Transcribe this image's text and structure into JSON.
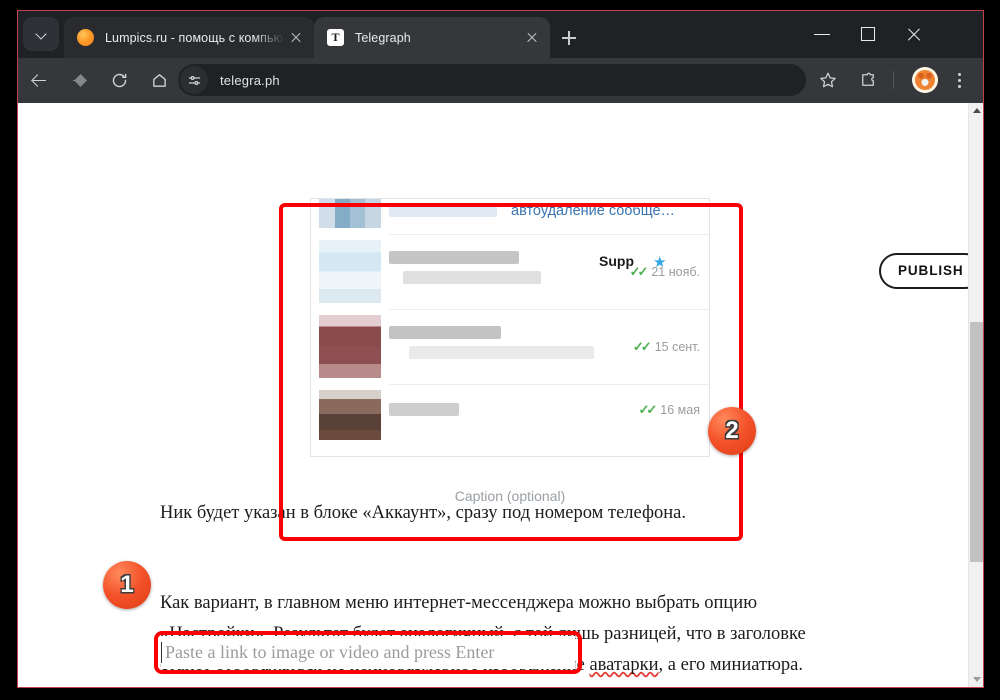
{
  "browser": {
    "window_controls": {
      "minimize": "minimize",
      "maximize": "maximize",
      "close": "close"
    },
    "tab_search_label": "tab-search",
    "new_tab_label": "New tab",
    "tabs": [
      {
        "title": "Lumpics.ru - помощь с компью",
        "favicon": "orange-circle-icon",
        "active": false
      },
      {
        "title": "Telegraph",
        "favicon": "T",
        "active": true
      }
    ],
    "toolbar": {
      "back": "Back",
      "forward": "Forward",
      "reload": "Reload",
      "home": "Home",
      "site_settings_icon": "tune-icon",
      "url": "telegra.ph",
      "bookmark": "Bookmark this tab",
      "extensions": "Extensions",
      "profile": "Profile",
      "menu": "Customize and control"
    }
  },
  "page": {
    "publish_button": "PUBLISH",
    "caption_placeholder": "Caption (optional)",
    "link_input_placeholder": "Paste a link to image or video and press Enter",
    "paragraphs": {
      "intro": "Ник будет указан в блоке «Аккаунт», сразу под номером телефона.",
      "after_a": "Как вариант, в главном меню интернет-мессенджера можно выбрать опцию «Настройки». Результат будет аналогичный, с той лишь разницей, что в заголовке станет отображаться не полноразмерное изображение ",
      "misspelled_word": "аватарки",
      "after_b": ", а его миниатюра."
    },
    "embedded_image": {
      "description": "telegram-chat-list-screenshot",
      "rows": [
        {
          "preview_text": "автоудаление сообще…",
          "date": "",
          "ticks": "✓✓",
          "avatar_tone": "blue"
        },
        {
          "preview_text": "",
          "name_fragment": "Supp",
          "verified": "★",
          "date": "21 нояб.",
          "ticks": "✓✓",
          "avatar_tone": "lightblue"
        },
        {
          "preview_text": "",
          "date": "15 сент.",
          "ticks": "✓✓",
          "avatar_tone": "maroon"
        },
        {
          "preview_text": "",
          "date": "16 мая",
          "ticks": "✓✓",
          "avatar_tone": "brown"
        }
      ]
    }
  },
  "annotations": [
    {
      "id": "2",
      "label": "2",
      "target": "image-embed-block"
    },
    {
      "id": "1",
      "label": "1",
      "target": "link-input-field"
    }
  ],
  "colors": {
    "annotation_red": "#fa0000",
    "badge_orange": "#f4522a",
    "link_blue": "#3a75b0",
    "tick_green": "#4caf50",
    "verified_blue": "#34a7e8"
  },
  "scrollbar": {
    "up_arrow": "▲",
    "down_arrow": "▼"
  }
}
